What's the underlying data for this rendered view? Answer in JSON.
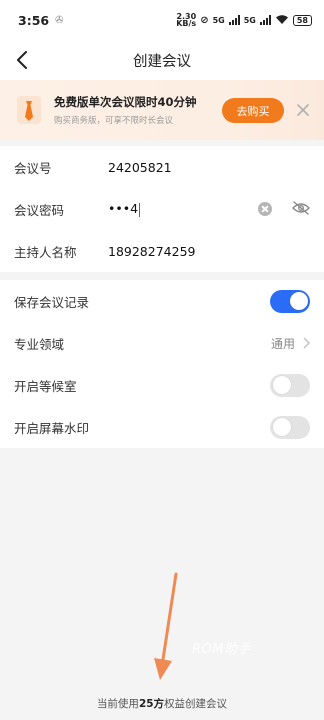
{
  "status": {
    "time": "3:56",
    "speed_top": "2.30",
    "speed_bottom": "KB/s",
    "net1": "5G",
    "net2": "5G",
    "battery": "58"
  },
  "nav": {
    "title": "创建会议"
  },
  "promo": {
    "title": "免费版单次会议限时40分钟",
    "subtitle": "购买商务版，可享不限时长会议",
    "button": "去购买"
  },
  "form": {
    "meeting_id": {
      "label": "会议号",
      "value": "24205821"
    },
    "password": {
      "label": "会议密码",
      "masked": "•••",
      "visible": "4"
    },
    "host": {
      "label": "主持人名称",
      "value": "18928274259"
    }
  },
  "settings": {
    "save_record": {
      "label": "保存会议记录",
      "on": true
    },
    "field": {
      "label": "专业领域",
      "value": "通用"
    },
    "waiting_room": {
      "label": "开启等候室",
      "on": false
    },
    "watermark": {
      "label": "开启屏幕水印",
      "on": false
    }
  },
  "overlay_watermark": "ROM助手",
  "footer": {
    "prefix": "当前使用",
    "highlight": "25方",
    "suffix": "权益创建会议"
  },
  "colors": {
    "accent": "#2a6cf6",
    "promo_button": "#f07a1c",
    "annotation_arrow": "#f08a55"
  }
}
